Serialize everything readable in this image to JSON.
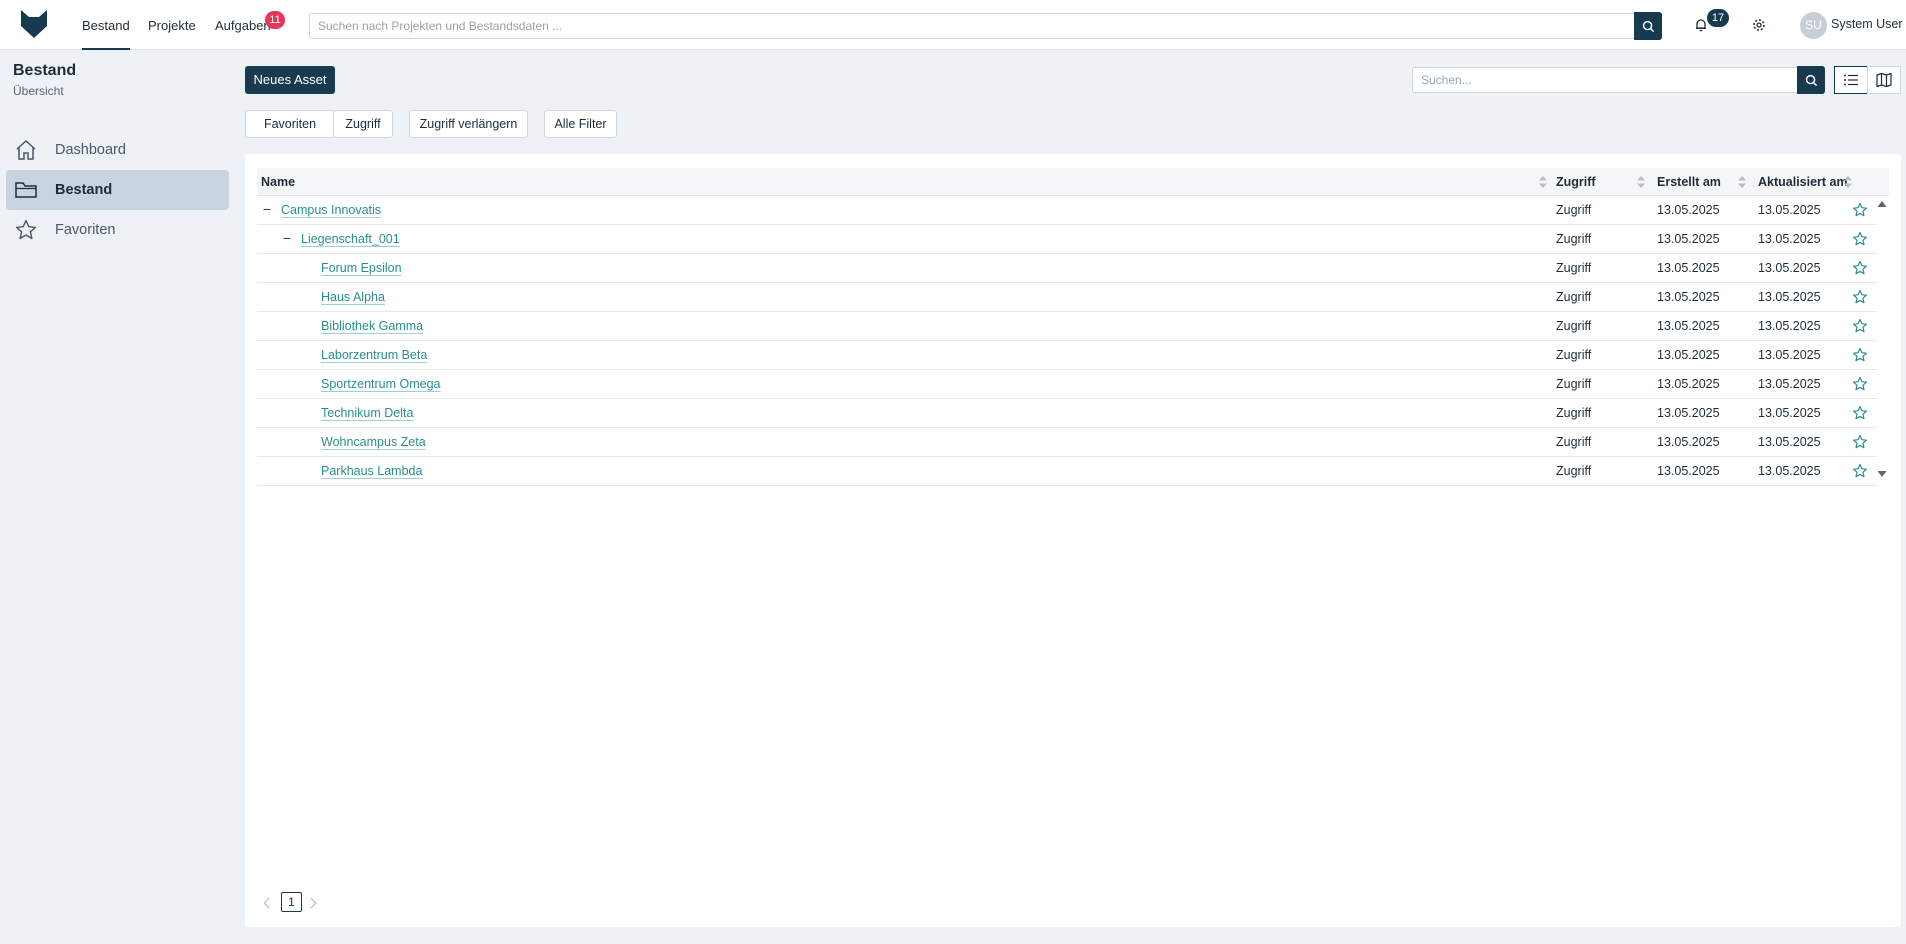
{
  "nav": {
    "items": [
      {
        "label": "Bestand",
        "active": true
      },
      {
        "label": "Projekte",
        "active": false
      },
      {
        "label": "Aufgaben",
        "badge": "11"
      }
    ]
  },
  "global_search": {
    "placeholder": "Suchen nach Projekten und Bestandsdaten ..."
  },
  "notifications": {
    "count": "17"
  },
  "user": {
    "initials": "SU",
    "name": "System User"
  },
  "sidebar": {
    "title": "Bestand",
    "subtitle": "Übersicht",
    "items": [
      {
        "label": "Dashboard",
        "icon": "home-icon"
      },
      {
        "label": "Bestand",
        "icon": "folder-icon",
        "active": true
      },
      {
        "label": "Favoriten",
        "icon": "star-icon"
      }
    ]
  },
  "toolbar": {
    "new_asset_label": "Neues Asset",
    "search_placeholder": "Suchen...",
    "filters": [
      "Favoriten",
      "Zugriff",
      "Zugriff verlängern",
      "Alle Filter"
    ]
  },
  "table": {
    "columns": [
      "Name",
      "Zugriff",
      "Erstellt am",
      "Aktualisiert am"
    ],
    "rows": [
      {
        "name": "Campus Innovatis",
        "level": 0,
        "expanded": true,
        "access": "Zugriff",
        "created": "13.05.2025",
        "updated": "13.05.2025"
      },
      {
        "name": "Liegenschaft_001",
        "level": 1,
        "expanded": true,
        "access": "Zugriff",
        "created": "13.05.2025",
        "updated": "13.05.2025"
      },
      {
        "name": "Forum Epsilon",
        "level": 2,
        "access": "Zugriff",
        "created": "13.05.2025",
        "updated": "13.05.2025"
      },
      {
        "name": "Haus Alpha",
        "level": 2,
        "access": "Zugriff",
        "created": "13.05.2025",
        "updated": "13.05.2025"
      },
      {
        "name": "Bibliothek Gamma",
        "level": 2,
        "access": "Zugriff",
        "created": "13.05.2025",
        "updated": "13.05.2025"
      },
      {
        "name": "Laborzentrum Beta",
        "level": 2,
        "access": "Zugriff",
        "created": "13.05.2025",
        "updated": "13.05.2025"
      },
      {
        "name": "Sportzentrum Omega",
        "level": 2,
        "access": "Zugriff",
        "created": "13.05.2025",
        "updated": "13.05.2025"
      },
      {
        "name": "Technikum Delta",
        "level": 2,
        "access": "Zugriff",
        "created": "13.05.2025",
        "updated": "13.05.2025"
      },
      {
        "name": "Wohncampus Zeta",
        "level": 2,
        "access": "Zugriff",
        "created": "13.05.2025",
        "updated": "13.05.2025"
      },
      {
        "name": "Parkhaus Lambda",
        "level": 2,
        "access": "Zugriff",
        "created": "13.05.2025",
        "updated": "13.05.2025"
      }
    ]
  },
  "pagination": {
    "current": "1"
  },
  "colors": {
    "primary": "#173a4f",
    "link": "#2a8f8a",
    "badge": "#e5355a",
    "background": "#eef2f7"
  }
}
